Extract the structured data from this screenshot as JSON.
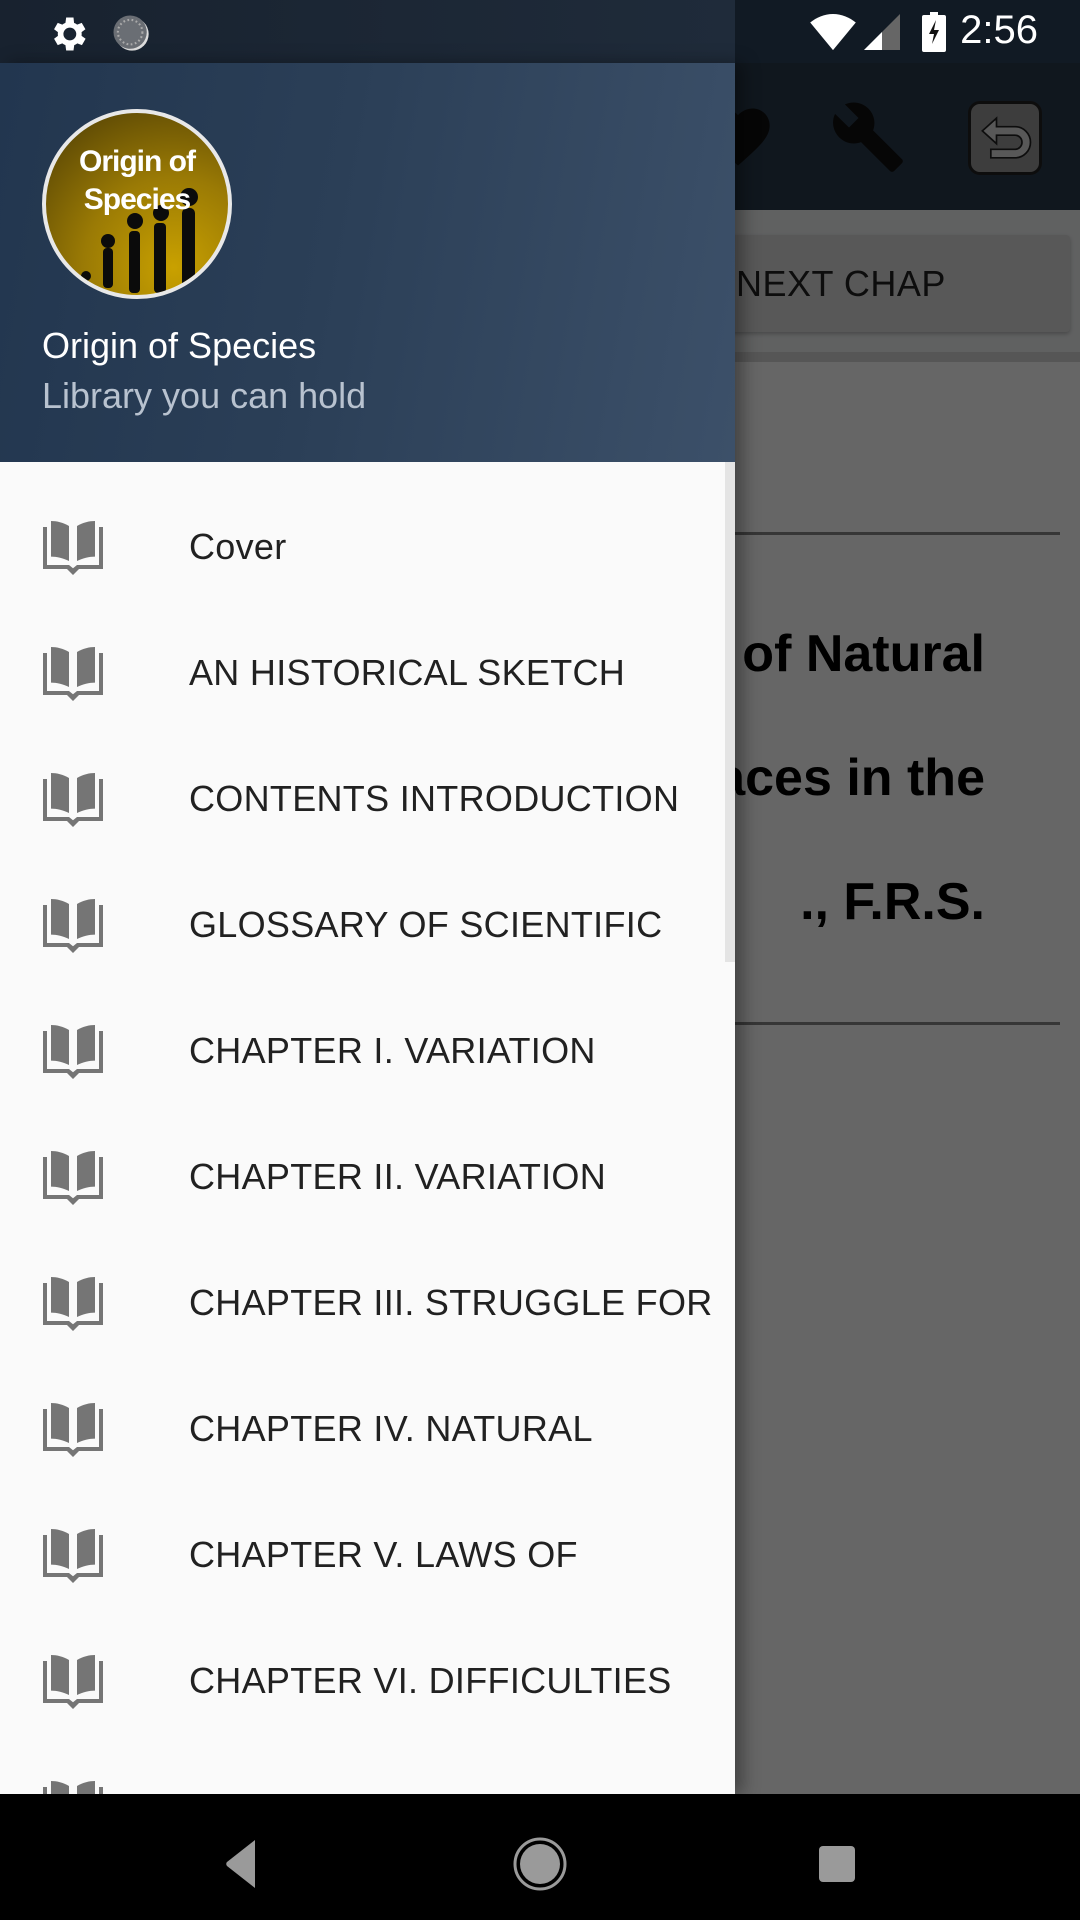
{
  "status_bar": {
    "time": "2:56",
    "left_icons": [
      "settings-icon",
      "sync-icon"
    ],
    "right_icons": [
      "wifi-icon",
      "signal-icon",
      "battery-charging-icon"
    ]
  },
  "background_app": {
    "toolbar_icons": [
      "favorite-icon",
      "wrench-icon",
      "undo-icon"
    ],
    "next_chapter_label": "NEXT CHAP",
    "visible_title_lines": [
      "s of Natural",
      "aces in the",
      "., F.R.S."
    ]
  },
  "drawer": {
    "app_name": "Origin of Species",
    "tagline": "Library you can hold",
    "logo_text_line1": "Origin of",
    "logo_text_line2": "Species",
    "items": [
      {
        "label": "Cover",
        "icon": "book-open-icon"
      },
      {
        "label": "AN HISTORICAL SKETCH",
        "icon": "book-open-icon"
      },
      {
        "label": "CONTENTS INTRODUCTION",
        "icon": "book-open-icon"
      },
      {
        "label": "GLOSSARY OF SCIENTIFIC",
        "icon": "book-open-icon"
      },
      {
        "label": "CHAPTER I. VARIATION",
        "icon": "book-open-icon"
      },
      {
        "label": "CHAPTER II. VARIATION",
        "icon": "book-open-icon"
      },
      {
        "label": "CHAPTER III. STRUGGLE FOR",
        "icon": "book-open-icon"
      },
      {
        "label": "CHAPTER IV. NATURAL",
        "icon": "book-open-icon"
      },
      {
        "label": "CHAPTER V. LAWS OF",
        "icon": "book-open-icon"
      },
      {
        "label": "CHAPTER VI. DIFFICULTIES",
        "icon": "book-open-icon"
      },
      {
        "label": "",
        "icon": "book-open-icon"
      }
    ]
  },
  "nav_bar": {
    "buttons": [
      "back",
      "home",
      "recents"
    ]
  },
  "colors": {
    "drawer_header_start": "#22364f",
    "drawer_header_end": "#3c5069",
    "menu_icon": "#757575",
    "menu_text": "#212121",
    "drawer_bg": "#fafafa"
  }
}
